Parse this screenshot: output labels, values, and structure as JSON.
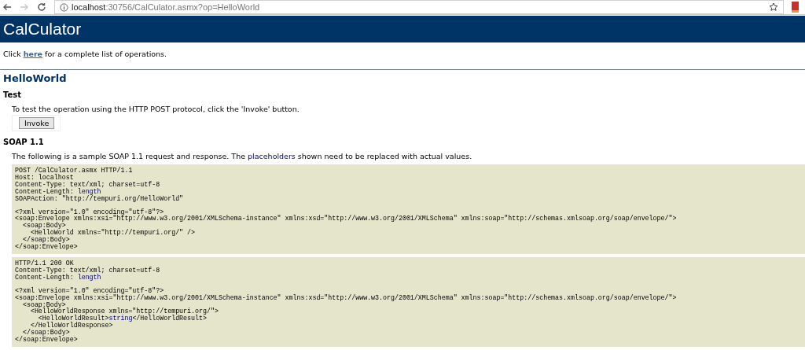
{
  "browser": {
    "url_host": "localhost",
    "url_rest": ":30756/CalCulator.asmx?op=HelloWorld",
    "forward_disabled": true
  },
  "header": {
    "title": "CalCulator"
  },
  "intro": {
    "before": "Click ",
    "link": "here",
    "after": " for a complete list of operations."
  },
  "operation": {
    "title": "HelloWorld"
  },
  "test": {
    "heading": "Test",
    "text": "To test the operation using the HTTP POST protocol, click the 'Invoke' button.",
    "button": "Invoke"
  },
  "soap": {
    "heading": "SOAP 1.1",
    "before": "The following is a sample SOAP 1.1 request and response. The ",
    "highlight": "placeholders",
    "after": " shown need to be replaced with actual values.",
    "blocks": [
      [
        [
          "POST /CalCulator.asmx HTTP/1.1",
          "Host: localhost",
          "Content-Type: text/xml; charset=utf-8",
          [
            {
              "text": "Content-Length: ",
              "placeholder": false
            },
            {
              "text": "length",
              "placeholder": true
            }
          ],
          "SOAPAction: \"http://tempuri.org/HelloWorld\""
        ],
        [
          "<?xml version=\"1.0\" encoding=\"utf-8\"?>",
          "<soap:Envelope xmlns:xsi=\"http://www.w3.org/2001/XMLSchema-instance\" xmlns:xsd=\"http://www.w3.org/2001/XMLSchema\" xmlns:soap=\"http://schemas.xmlsoap.org/soap/envelope/\">",
          "  <soap:Body>",
          "    <HelloWorld xmlns=\"http://tempuri.org/\" />",
          "  </soap:Body>",
          "</soap:Envelope>"
        ]
      ],
      [
        [
          "HTTP/1.1 200 OK",
          "Content-Type: text/xml; charset=utf-8",
          [
            {
              "text": "Content-Length: ",
              "placeholder": false
            },
            {
              "text": "length",
              "placeholder": true
            }
          ]
        ],
        [
          "<?xml version=\"1.0\" encoding=\"utf-8\"?>",
          "<soap:Envelope xmlns:xsi=\"http://www.w3.org/2001/XMLSchema-instance\" xmlns:xsd=\"http://www.w3.org/2001/XMLSchema\" xmlns:soap=\"http://schemas.xmlsoap.org/soap/envelope/\">",
          "  <soap:Body>",
          "    <HelloWorldResponse xmlns=\"http://tempuri.org/\">",
          [
            {
              "text": "      <HelloWorldResult>",
              "placeholder": false
            },
            {
              "text": "string",
              "placeholder": true
            },
            {
              "text": "</HelloWorldResult>",
              "placeholder": false
            }
          ],
          "    </HelloWorldResponse>",
          "  </soap:Body>",
          "</soap:Envelope>"
        ]
      ]
    ]
  }
}
